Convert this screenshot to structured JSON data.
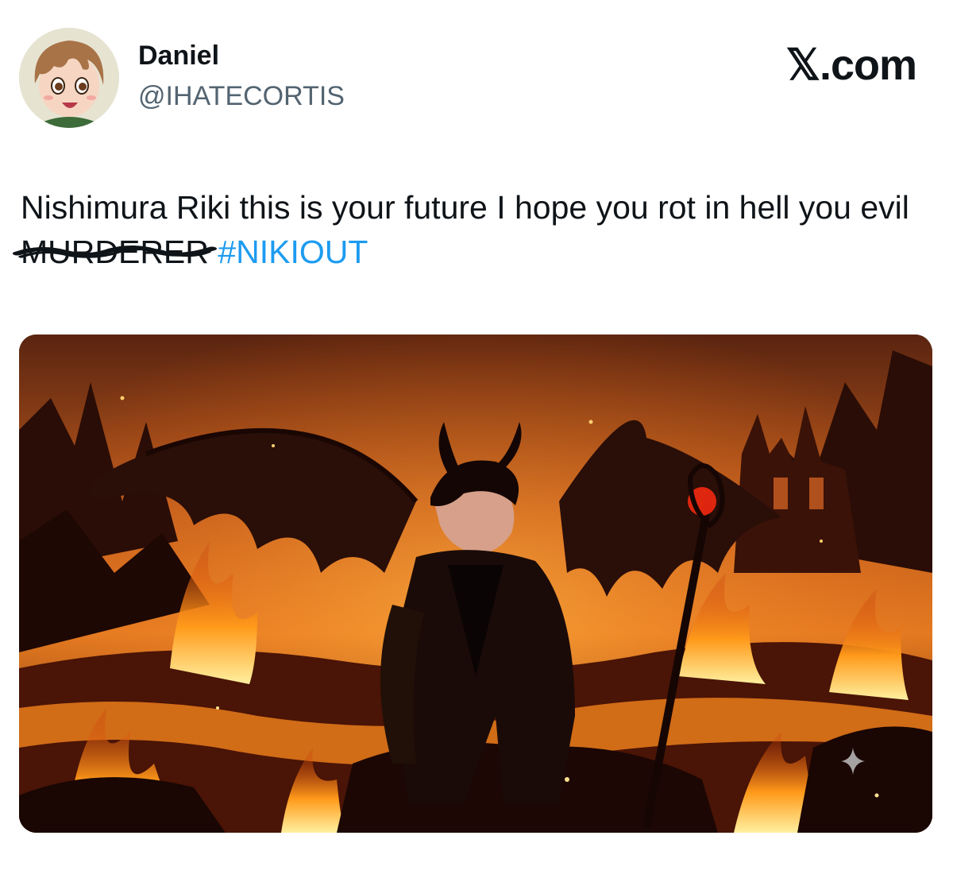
{
  "author": {
    "display_name": "Daniel",
    "handle": "@IHATECORTIS",
    "avatar_icon": "anime-boy-avatar-icon"
  },
  "brand": {
    "label": "𝕏.com"
  },
  "tweet": {
    "text_before": "Nishimura Riki this is your future I hope you rot in hell you evil",
    "struck_word": "MURDERER",
    "hashtag": "#NIKIOUT"
  },
  "media": {
    "icon": "demon-figure-in-hellfire-image",
    "ai_badge_icon": "sparkle-icon"
  },
  "colors": {
    "link": "#1d9bf0",
    "text": "#0f1419",
    "secondary": "#536471"
  }
}
